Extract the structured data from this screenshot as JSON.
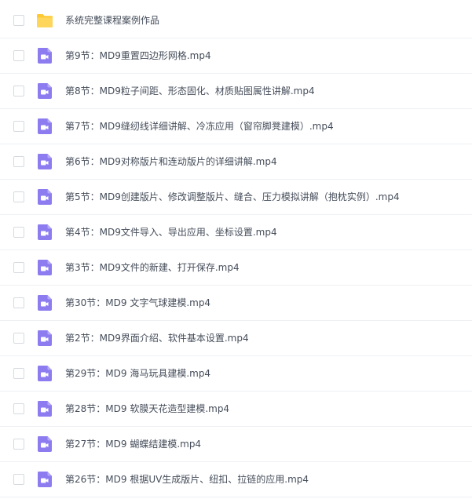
{
  "file_list": {
    "items": [
      {
        "name": "系统完整课程案例作品",
        "type": "folder",
        "icon": "folder-icon"
      },
      {
        "name": "第9节：MD9重置四边形网格.mp4",
        "type": "video",
        "icon": "video-file-icon"
      },
      {
        "name": "第8节：MD9粒子间距、形态固化、材质贴图属性讲解.mp4",
        "type": "video",
        "icon": "video-file-icon"
      },
      {
        "name": "第7节：MD9缝纫线详细讲解、冷冻应用（窗帘脚凳建模）.mp4",
        "type": "video",
        "icon": "video-file-icon"
      },
      {
        "name": "第6节：MD9对称版片和连动版片的详细讲解.mp4",
        "type": "video",
        "icon": "video-file-icon"
      },
      {
        "name": "第5节：MD9创建版片、修改调整版片、缝合、压力模拟讲解（抱枕实例）.mp4",
        "type": "video",
        "icon": "video-file-icon"
      },
      {
        "name": "第4节：MD9文件导入、导出应用、坐标设置.mp4",
        "type": "video",
        "icon": "video-file-icon"
      },
      {
        "name": "第3节：MD9文件的新建、打开保存.mp4",
        "type": "video",
        "icon": "video-file-icon"
      },
      {
        "name": "第30节：MD9 文字气球建模.mp4",
        "type": "video",
        "icon": "video-file-icon"
      },
      {
        "name": "第2节：MD9界面介绍、软件基本设置.mp4",
        "type": "video",
        "icon": "video-file-icon"
      },
      {
        "name": "第29节：MD9 海马玩具建模.mp4",
        "type": "video",
        "icon": "video-file-icon"
      },
      {
        "name": "第28节：MD9 软膜天花造型建模.mp4",
        "type": "video",
        "icon": "video-file-icon"
      },
      {
        "name": "第27节：MD9 蝴蝶结建模.mp4",
        "type": "video",
        "icon": "video-file-icon"
      },
      {
        "name": "第26节：MD9 根据UV生成版片、纽扣、拉链的应用.mp4",
        "type": "video",
        "icon": "video-file-icon"
      }
    ]
  },
  "colors": {
    "text": "#454d5a",
    "folder": "#ffd65c",
    "video": "#8c7cf0",
    "divider": "#eef0f4",
    "checkbox_border": "#d6dae0"
  }
}
